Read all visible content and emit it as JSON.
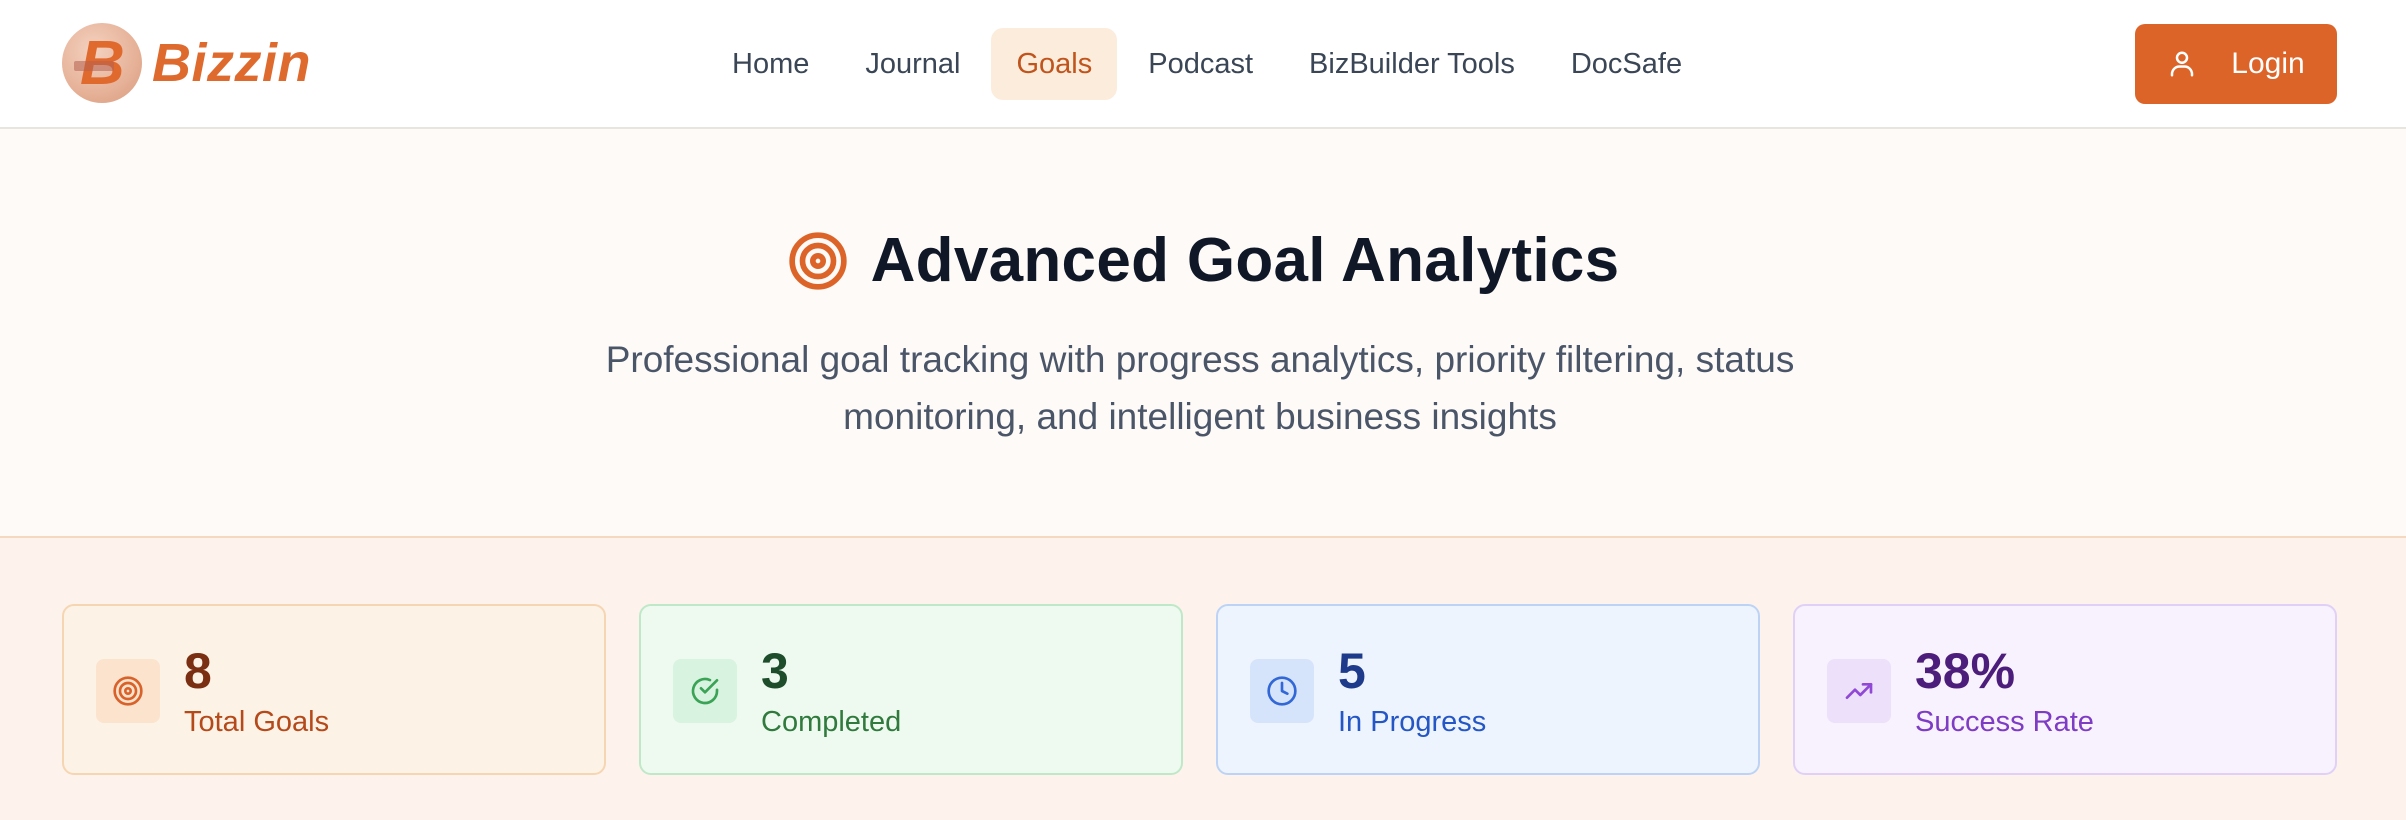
{
  "brand": {
    "name": "Bizzin"
  },
  "nav": {
    "items": [
      {
        "label": "Home",
        "active": false
      },
      {
        "label": "Journal",
        "active": false
      },
      {
        "label": "Goals",
        "active": true
      },
      {
        "label": "Podcast",
        "active": false
      },
      {
        "label": "BizBuilder Tools",
        "active": false
      },
      {
        "label": "DocSafe",
        "active": false
      }
    ],
    "login_label": "Login"
  },
  "hero": {
    "title": "Advanced Goal Analytics",
    "subtitle": "Professional goal tracking with progress analytics, priority filtering, status monitoring, and intelligent business insights",
    "icon": "target-icon"
  },
  "stats": [
    {
      "value": "8",
      "label": "Total Goals",
      "icon": "target-icon",
      "bg": "#fdf2e6",
      "border": "#f6d5b2",
      "icon_bg": "#fbe3cd",
      "value_color": "#7a2e12",
      "label_color": "#b4491a",
      "icon_color": "#d9622b"
    },
    {
      "value": "3",
      "label": "Completed",
      "icon": "check-circle-icon",
      "bg": "#eefaf0",
      "border": "#bfe8c8",
      "icon_bg": "#d8f3df",
      "value_color": "#1e4d2b",
      "label_color": "#2f7a3c",
      "icon_color": "#3aa356"
    },
    {
      "value": "5",
      "label": "In Progress",
      "icon": "clock-icon",
      "bg": "#eef4fd",
      "border": "#bcd3f5",
      "icon_bg": "#d6e4fb",
      "value_color": "#1e3a8a",
      "label_color": "#2457c5",
      "icon_color": "#3167d6"
    },
    {
      "value": "38%",
      "label": "Success Rate",
      "icon": "trending-up-icon",
      "bg": "#f7f2fd",
      "border": "#e0d0f7",
      "icon_bg": "#ece0fb",
      "value_color": "#4c1d7a",
      "label_color": "#7e3bc4",
      "icon_color": "#9248d6"
    }
  ]
}
